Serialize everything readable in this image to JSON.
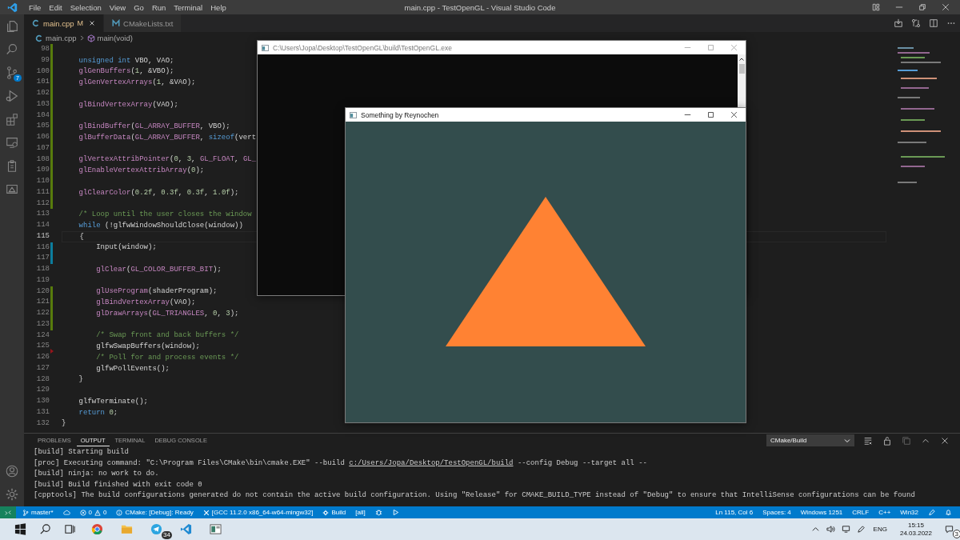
{
  "title_bar": {
    "menu": [
      "File",
      "Edit",
      "Selection",
      "View",
      "Go",
      "Run",
      "Terminal",
      "Help"
    ],
    "title": "main.cpp - TestOpenGL - Visual Studio Code"
  },
  "activity_bar": {
    "source_control_badge": "7"
  },
  "tabs": [
    {
      "label": "main.cpp",
      "kind": "cpp",
      "status": "M",
      "modified": true,
      "selected": true
    },
    {
      "label": "CMakeLists.txt",
      "kind": "cmake",
      "modified": false,
      "selected": false
    }
  ],
  "breadcrumb": {
    "file": "main.cpp",
    "symbol": "main(void)"
  },
  "editor": {
    "lines": [
      {
        "number": "98",
        "current": false,
        "marker": {
          "kind": "bar",
          "color": "#587c0c"
        }
      },
      {
        "number": "99",
        "current": false,
        "marker": {
          "kind": "bar",
          "color": "#587c0c"
        },
        "segments": [
          {
            "kind": "keyword",
            "text": "    unsigned int"
          },
          {
            "kind": "plain",
            "text": " VBO, VAO;"
          }
        ]
      },
      {
        "number": "100",
        "current": false,
        "marker": {
          "kind": "bar",
          "color": "#587c0c"
        },
        "segments": [
          {
            "kind": "function",
            "text": "    glGenBuffers"
          },
          {
            "kind": "plain",
            "text": "("
          },
          {
            "kind": "number",
            "text": "1"
          },
          {
            "kind": "plain",
            "text": ", &VBO);"
          }
        ]
      },
      {
        "number": "101",
        "current": false,
        "marker": {
          "kind": "bar",
          "color": "#587c0c"
        },
        "segments": [
          {
            "kind": "function",
            "text": "    glGenVertexArrays"
          },
          {
            "kind": "plain",
            "text": "("
          },
          {
            "kind": "number",
            "text": "1"
          },
          {
            "kind": "plain",
            "text": ", &VAO);"
          }
        ]
      },
      {
        "number": "102",
        "current": false,
        "marker": {
          "kind": "bar",
          "color": "#587c0c"
        }
      },
      {
        "number": "103",
        "current": false,
        "marker": {
          "kind": "bar",
          "color": "#587c0c"
        },
        "segments": [
          {
            "kind": "function",
            "text": "    glBindVertexArray"
          },
          {
            "kind": "plain",
            "text": "(VAO);"
          }
        ]
      },
      {
        "number": "104",
        "current": false,
        "marker": {
          "kind": "bar",
          "color": "#587c0c"
        }
      },
      {
        "number": "105",
        "current": false,
        "marker": {
          "kind": "bar",
          "color": "#587c0c"
        },
        "segments": [
          {
            "kind": "function",
            "text": "    glBindBuffer"
          },
          {
            "kind": "plain",
            "text": "("
          },
          {
            "kind": "function",
            "text": "GL_ARRAY_BUFFER"
          },
          {
            "kind": "plain",
            "text": ", VBO);"
          }
        ]
      },
      {
        "number": "106",
        "current": false,
        "marker": {
          "kind": "bar",
          "color": "#587c0c"
        },
        "segments": [
          {
            "kind": "function",
            "text": "    glBufferData"
          },
          {
            "kind": "plain",
            "text": "("
          },
          {
            "kind": "function",
            "text": "GL_ARRAY_BUFFER"
          },
          {
            "kind": "plain",
            "text": ", "
          },
          {
            "kind": "keyword",
            "text": "sizeof"
          },
          {
            "kind": "plain",
            "text": "(vert"
          }
        ]
      },
      {
        "number": "107",
        "current": false,
        "marker": {
          "kind": "bar",
          "color": "#587c0c"
        }
      },
      {
        "number": "108",
        "current": false,
        "marker": {
          "kind": "bar",
          "color": "#587c0c"
        },
        "segments": [
          {
            "kind": "function",
            "text": "    glVertexAttribPointer"
          },
          {
            "kind": "plain",
            "text": "("
          },
          {
            "kind": "number",
            "text": "0"
          },
          {
            "kind": "plain",
            "text": ", "
          },
          {
            "kind": "number",
            "text": "3"
          },
          {
            "kind": "plain",
            "text": ", "
          },
          {
            "kind": "function",
            "text": "GL_FLOAT"
          },
          {
            "kind": "plain",
            "text": ", "
          },
          {
            "kind": "function",
            "text": "GL_"
          }
        ]
      },
      {
        "number": "109",
        "current": false,
        "marker": {
          "kind": "bar",
          "color": "#587c0c"
        },
        "segments": [
          {
            "kind": "function",
            "text": "    glEnableVertexAttribArray"
          },
          {
            "kind": "plain",
            "text": "("
          },
          {
            "kind": "number",
            "text": "0"
          },
          {
            "kind": "plain",
            "text": ");"
          }
        ]
      },
      {
        "number": "110",
        "current": false,
        "marker": {
          "kind": "bar",
          "color": "#587c0c"
        }
      },
      {
        "number": "111",
        "current": false,
        "marker": {
          "kind": "bar",
          "color": "#587c0c"
        },
        "segments": [
          {
            "kind": "function",
            "text": "    glClearColor"
          },
          {
            "kind": "plain",
            "text": "("
          },
          {
            "kind": "number",
            "text": "0.2f"
          },
          {
            "kind": "plain",
            "text": ", "
          },
          {
            "kind": "number",
            "text": "0.3f"
          },
          {
            "kind": "plain",
            "text": ", "
          },
          {
            "kind": "number",
            "text": "0.3f"
          },
          {
            "kind": "plain",
            "text": ", "
          },
          {
            "kind": "number",
            "text": "1.0f"
          },
          {
            "kind": "plain",
            "text": ");"
          }
        ]
      },
      {
        "number": "112",
        "current": false,
        "marker": {
          "kind": "bar",
          "color": "#587c0c"
        }
      },
      {
        "number": "113",
        "current": false,
        "segments": [
          {
            "kind": "comment",
            "text": "    /* Loop until the user closes the window"
          }
        ]
      },
      {
        "number": "114",
        "current": false,
        "segments": [
          {
            "kind": "keyword",
            "text": "    while"
          },
          {
            "kind": "plain",
            "text": " (!glfwWindowShouldClose(window))"
          }
        ]
      },
      {
        "number": "115",
        "current": true,
        "segments": [
          {
            "kind": "plain",
            "text": "    {"
          }
        ]
      },
      {
        "number": "116",
        "current": false,
        "marker": {
          "kind": "bar",
          "color": "#0c7d9d"
        },
        "segments": [
          {
            "kind": "plain",
            "text": "        Input(window);"
          }
        ]
      },
      {
        "number": "117",
        "current": false,
        "marker": {
          "kind": "bar",
          "color": "#0c7d9d"
        }
      },
      {
        "number": "118",
        "current": false,
        "segments": [
          {
            "kind": "function",
            "text": "        glClear"
          },
          {
            "kind": "plain",
            "text": "("
          },
          {
            "kind": "function",
            "text": "GL_COLOR_BUFFER_BIT"
          },
          {
            "kind": "plain",
            "text": ");"
          }
        ]
      },
      {
        "number": "119",
        "current": false
      },
      {
        "number": "120",
        "current": false,
        "marker": {
          "kind": "bar",
          "color": "#587c0c"
        },
        "segments": [
          {
            "kind": "function",
            "text": "        glUseProgram"
          },
          {
            "kind": "plain",
            "text": "(shaderProgram);"
          }
        ]
      },
      {
        "number": "121",
        "current": false,
        "marker": {
          "kind": "bar",
          "color": "#587c0c"
        },
        "segments": [
          {
            "kind": "function",
            "text": "        glBindVertexArray"
          },
          {
            "kind": "plain",
            "text": "(VAO);"
          }
        ]
      },
      {
        "number": "122",
        "current": false,
        "marker": {
          "kind": "bar",
          "color": "#587c0c"
        },
        "segments": [
          {
            "kind": "function",
            "text": "        glDrawArrays"
          },
          {
            "kind": "plain",
            "text": "("
          },
          {
            "kind": "function",
            "text": "GL_TRIANGLES"
          },
          {
            "kind": "plain",
            "text": ", "
          },
          {
            "kind": "number",
            "text": "0"
          },
          {
            "kind": "plain",
            "text": ", "
          },
          {
            "kind": "number",
            "text": "3"
          },
          {
            "kind": "plain",
            "text": ");"
          }
        ]
      },
      {
        "number": "123",
        "current": false,
        "marker": {
          "kind": "bar",
          "color": "#587c0c"
        }
      },
      {
        "number": "124",
        "current": false,
        "segments": [
          {
            "kind": "comment",
            "text": "        /* Swap front and back buffers */"
          }
        ]
      },
      {
        "number": "125",
        "current": false,
        "marker": {
          "kind": "triangle",
          "color": "#94151b"
        },
        "segments": [
          {
            "kind": "plain",
            "text": "        glfwSwapBuffers(window);"
          }
        ]
      },
      {
        "number": "126",
        "current": false,
        "segments": [
          {
            "kind": "comment",
            "text": "        /* Poll for and process events */"
          }
        ]
      },
      {
        "number": "127",
        "current": false,
        "segments": [
          {
            "kind": "plain",
            "text": "        glfwPollEvents();"
          }
        ]
      },
      {
        "number": "128",
        "current": false,
        "segments": [
          {
            "kind": "plain",
            "text": "    }"
          }
        ]
      },
      {
        "number": "129",
        "current": false
      },
      {
        "number": "130",
        "current": false,
        "segments": [
          {
            "kind": "plain",
            "text": "    glfwTerminate();"
          }
        ]
      },
      {
        "number": "131",
        "current": false,
        "segments": [
          {
            "kind": "keyword",
            "text": "    return"
          },
          {
            "kind": "number",
            "text": " 0"
          },
          {
            "kind": "plain",
            "text": ";"
          }
        ]
      },
      {
        "number": "132",
        "current": false,
        "segments": [
          {
            "kind": "plain",
            "text": "}"
          }
        ]
      }
    ]
  },
  "panel": {
    "tabs": [
      {
        "label": "PROBLEMS",
        "selected": false
      },
      {
        "label": "OUTPUT",
        "selected": true
      },
      {
        "label": "TERMINAL",
        "selected": false
      },
      {
        "label": "DEBUG CONSOLE",
        "selected": false
      }
    ],
    "output_channel": "CMake/Build",
    "output": [
      {
        "text": "[build] Starting build"
      },
      {
        "text": "[proc] Executing command: \"C:\\Program Files\\CMake\\bin\\cmake.EXE\" --build ",
        "link": "c:/Users/Jopa/Desktop/TestOpenGL/build",
        "after": " --config Debug --target all --"
      },
      {
        "text": "[build] ninja: no work to do."
      },
      {
        "text": "[build] Build finished with exit code 0"
      },
      {
        "text": "[cpptools] The build configurations generated do not contain the active build configuration. Using \"Release\" for CMAKE_BUILD_TYPE instead of \"Debug\" to ensure that IntelliSense configurations can be found"
      }
    ]
  },
  "status_bar": {
    "branch": "master*",
    "errors": "0",
    "warnings": "0",
    "cmake_status": "CMake: [Debug]: Ready",
    "kit": "[GCC 11.2.0 x86_64-w64-mingw32]",
    "build": "Build",
    "target": "[all]",
    "right": [
      "Ln 115, Col 6",
      "Spaces: 4",
      "Windows 1251",
      "CRLF",
      "C++",
      "Win32"
    ]
  },
  "console_window": {
    "title": "C:\\Users\\Jopa\\Desktop\\TestOpenGL\\build\\TestOpenGL.exe"
  },
  "gl_window": {
    "title": "Something by Reynochen"
  },
  "taskbar": {
    "apps": [
      {
        "kind": "browser"
      },
      {
        "kind": "folder"
      },
      {
        "kind": "messenger",
        "badge": "34"
      },
      {
        "kind": "editor"
      },
      {
        "kind": "app"
      }
    ],
    "language": "ENG",
    "time": "15:15",
    "date": "24.03.2022",
    "notifications": "3"
  }
}
